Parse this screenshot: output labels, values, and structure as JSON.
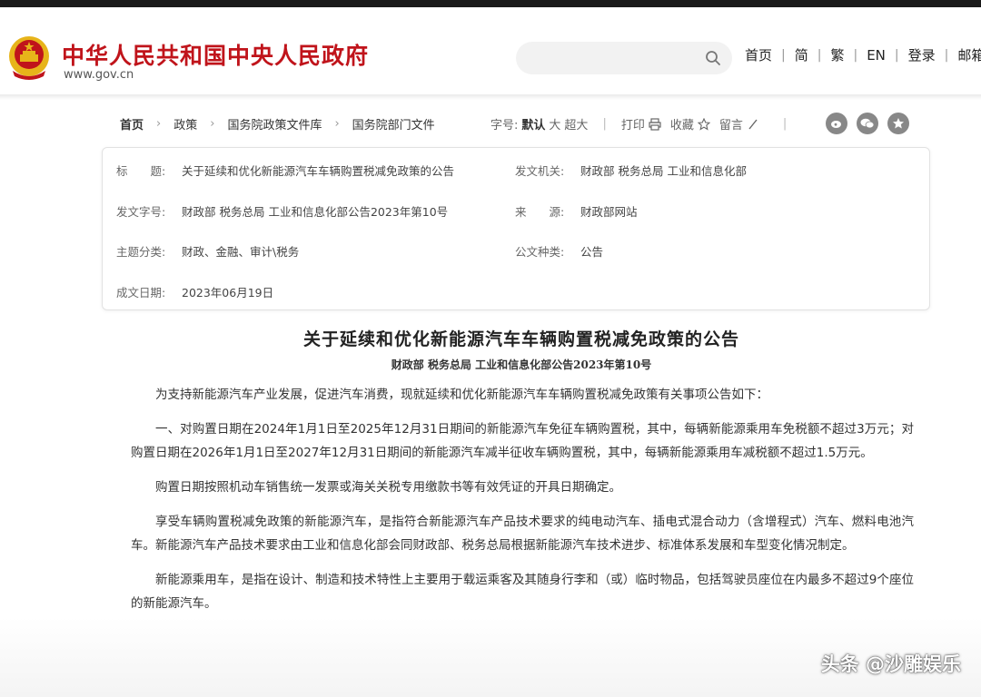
{
  "header": {
    "site_name": "中华人民共和国中央人民政府",
    "site_url": "www.gov.cn",
    "nav": [
      "首页",
      "简",
      "繁",
      "EN",
      "登录",
      "邮箱"
    ]
  },
  "breadcrumb": [
    "首页",
    "政策",
    "国务院政策文件库",
    "国务院部门文件"
  ],
  "tools": {
    "font_label": "字号:",
    "font_default": "默认",
    "font_large": "大",
    "font_xlarge": "超大",
    "print": "打印",
    "favorite": "收藏",
    "comment": "留言"
  },
  "meta": {
    "title_label": "标　　题:",
    "title": "关于延续和优化新能源汽车车辆购置税减免政策的公告",
    "issuer_label": "发文机关:",
    "issuer": "财政部 税务总局 工业和信息化部",
    "doc_no_label": "发文字号:",
    "doc_no": "财政部 税务总局 工业和信息化部公告2023年第10号",
    "source_label": "来　　源:",
    "source": "财政部网站",
    "category_label": "主题分类:",
    "category": "财政、金融、审计\\税务",
    "doc_type_label": "公文种类:",
    "doc_type": "公告",
    "date_label": "成文日期:",
    "date": "2023年06月19日"
  },
  "article": {
    "title": "关于延续和优化新能源汽车车辆购置税减免政策的公告",
    "doc_number": "财政部 税务总局 工业和信息化部公告2023年第10号",
    "paragraphs": [
      "为支持新能源汽车产业发展，促进汽车消费，现就延续和优化新能源汽车车辆购置税减免政策有关事项公告如下：",
      "一、对购置日期在2024年1月1日至2025年12月31日期间的新能源汽车免征车辆购置税，其中，每辆新能源乘用车免税额不超过3万元；对购置日期在2026年1月1日至2027年12月31日期间的新能源汽车减半征收车辆购置税，其中，每辆新能源乘用车减税额不超过1.5万元。",
      "购置日期按照机动车销售统一发票或海关关税专用缴款书等有效凭证的开具日期确定。",
      "享受车辆购置税减免政策的新能源汽车，是指符合新能源汽车产品技术要求的纯电动汽车、插电式混合动力（含增程式）汽车、燃料电池汽车。新能源汽车产品技术要求由工业和信息化部会同财政部、税务总局根据新能源汽车技术进步、标准体系发展和车型变化情况制定。",
      "新能源乘用车，是指在设计、制造和技术特性上主要用于载运乘客及其随身行李和（或）临时物品，包括驾驶员座位在内最多不超过9个座位的新能源汽车。"
    ]
  },
  "watermark": "头条 @沙雕娱乐",
  "colors": {
    "brand_red": "#c0141b",
    "emblem_gold": "#e7b41a"
  }
}
